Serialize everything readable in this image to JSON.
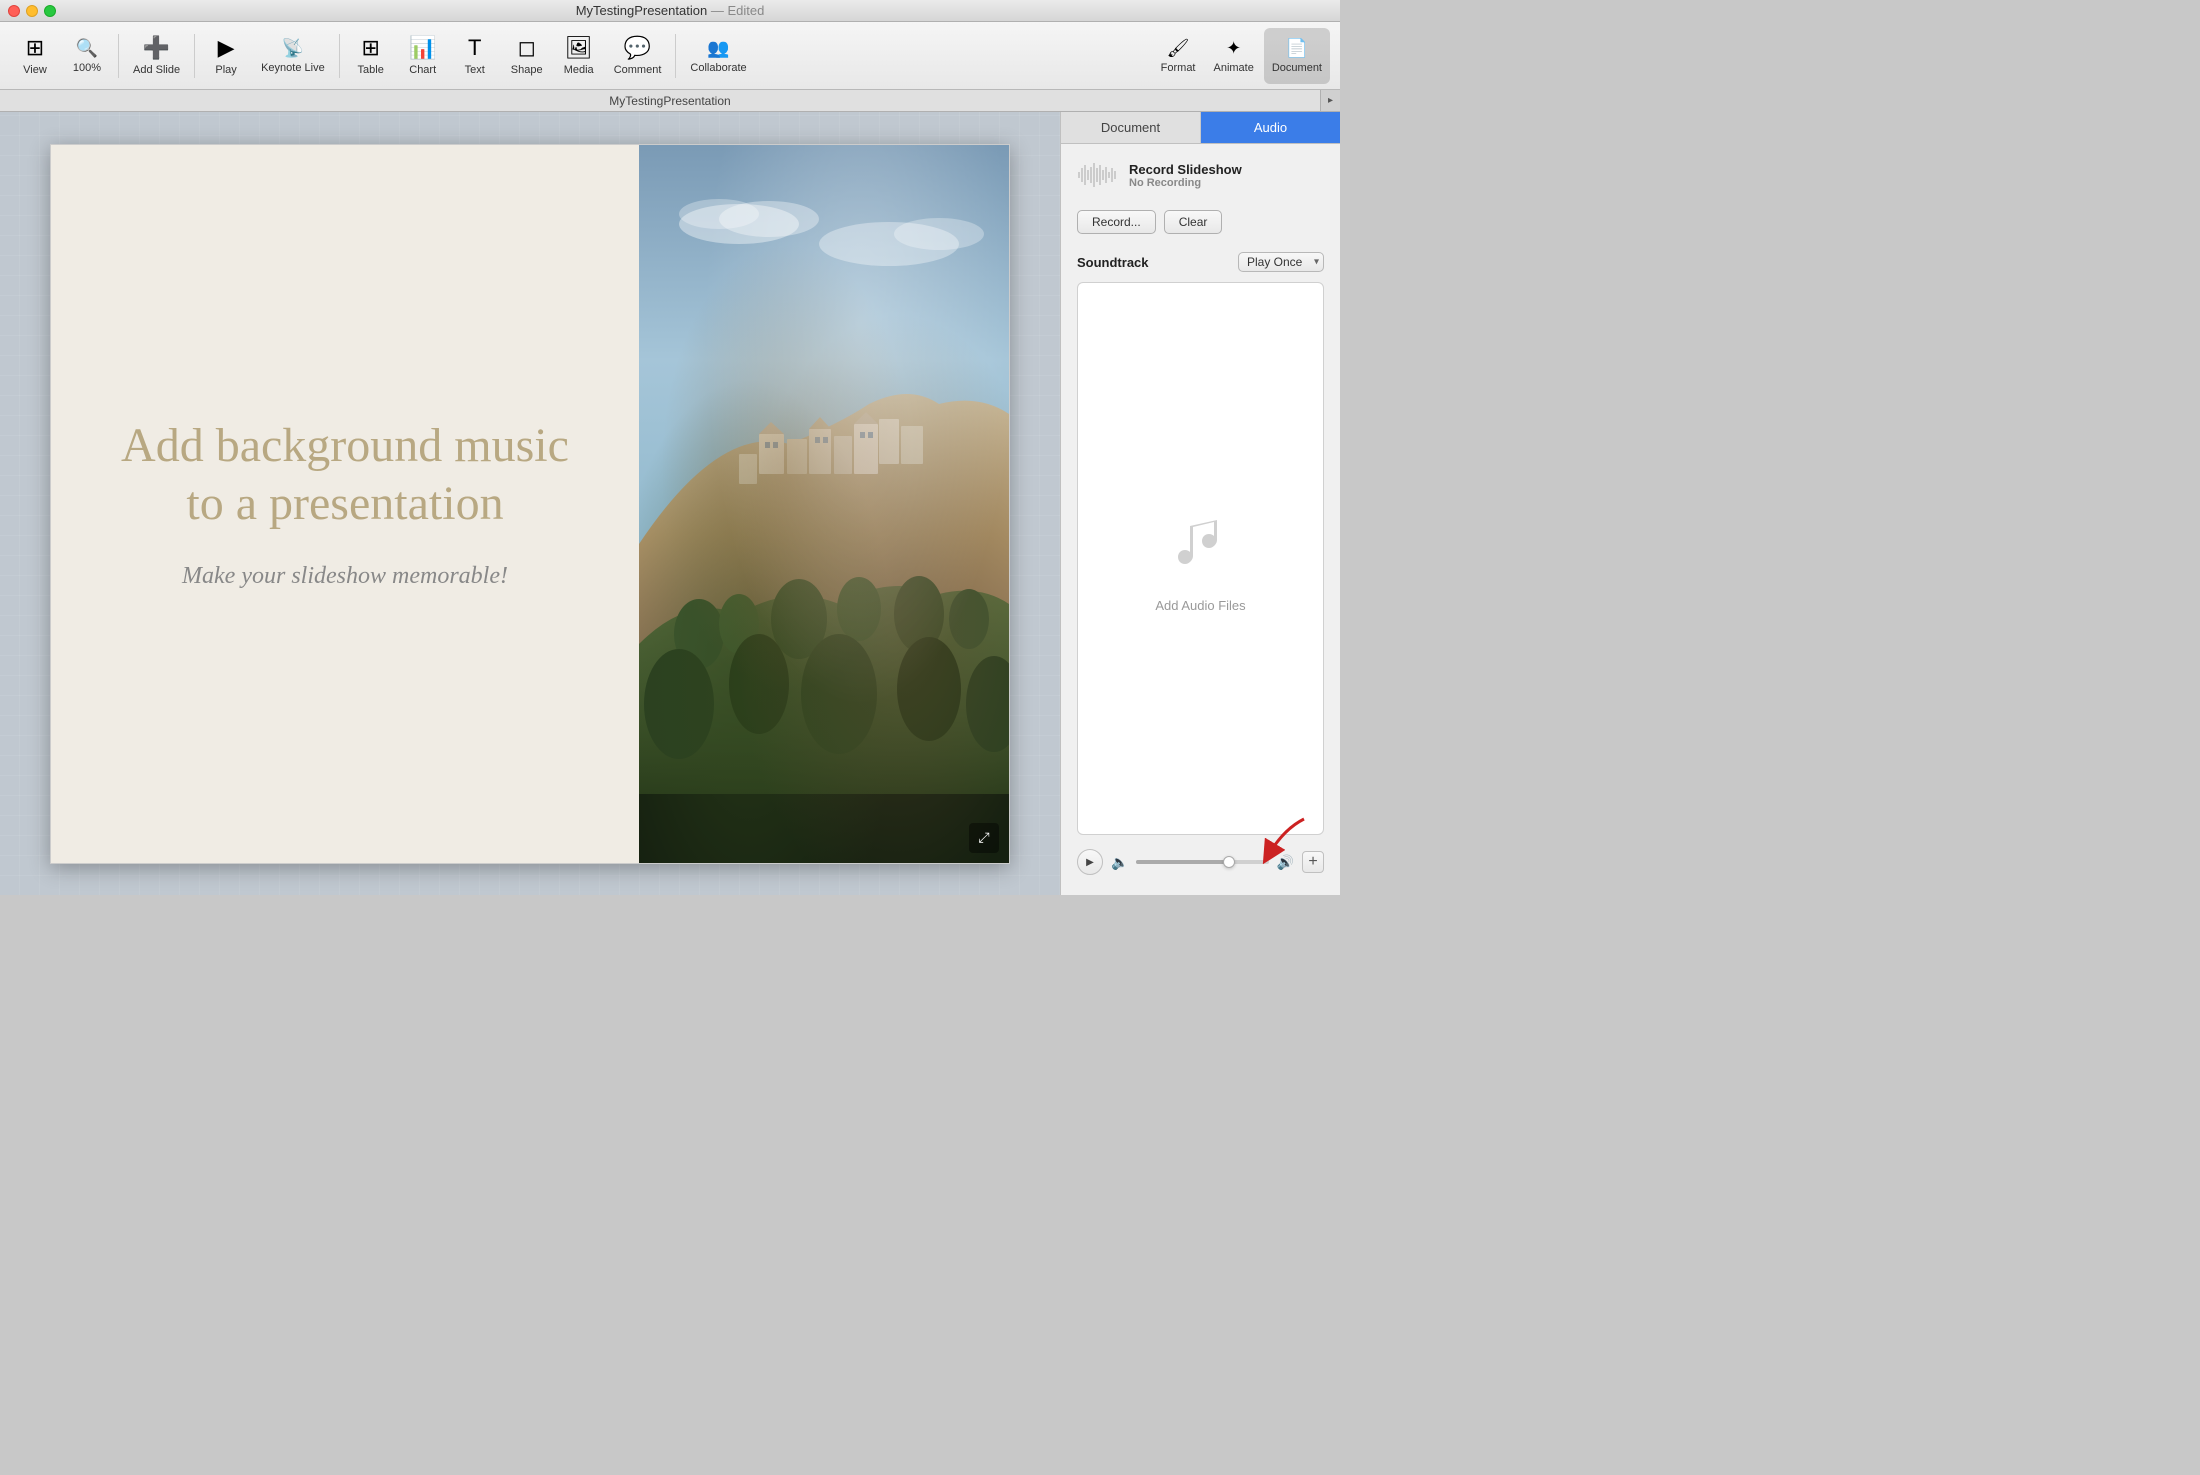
{
  "window": {
    "title": "MyTestingPresentation",
    "edited": "— Edited"
  },
  "toolbar": {
    "view_label": "View",
    "zoom_label": "100%",
    "add_slide_label": "Add Slide",
    "play_label": "Play",
    "keynote_live_label": "Keynote Live",
    "table_label": "Table",
    "chart_label": "Chart",
    "text_label": "Text",
    "shape_label": "Shape",
    "media_label": "Media",
    "comment_label": "Comment",
    "collaborate_label": "Collaborate",
    "format_label": "Format",
    "animate_label": "Animate",
    "document_label": "Document"
  },
  "doc_tab": {
    "name": "MyTestingPresentation"
  },
  "panel": {
    "document_tab": "Document",
    "audio_tab": "Audio",
    "record_title": "Record Slideshow",
    "record_status": "No Recording",
    "record_button": "Record...",
    "clear_button": "Clear",
    "soundtrack_label": "Soundtrack",
    "play_once_option": "Play Once",
    "audio_files_label": "Add Audio Files"
  },
  "slide": {
    "title": "Add background music to a presentation",
    "subtitle": "Make your slideshow memorable!"
  },
  "waveform_bars": [
    3,
    8,
    14,
    20,
    16,
    10,
    18,
    22,
    15,
    8,
    12,
    19,
    14,
    7,
    11,
    17,
    13,
    6,
    9,
    16
  ]
}
